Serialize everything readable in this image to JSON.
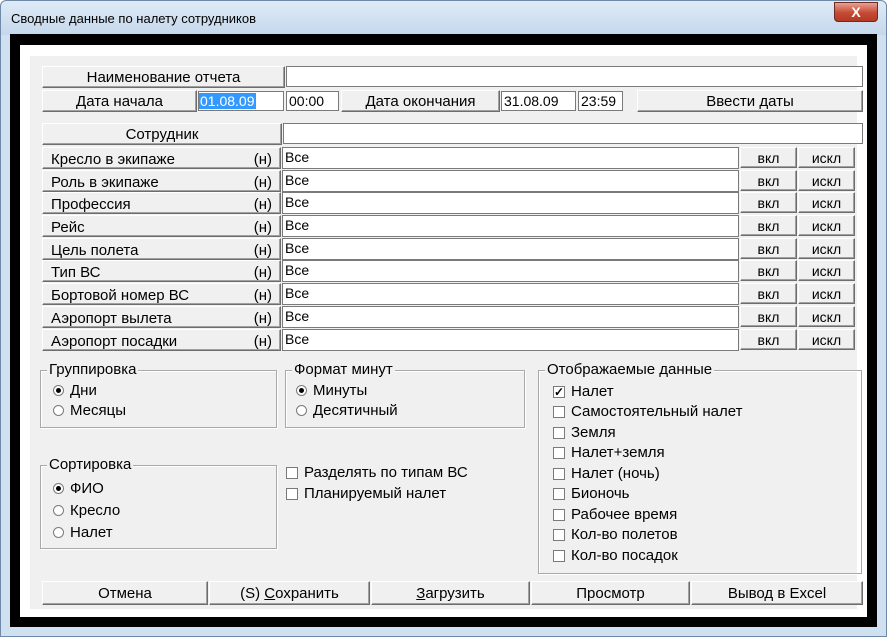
{
  "window": {
    "title": "Сводные данные по налету сотрудников",
    "close_label": "X"
  },
  "report": {
    "name_label": "Наименование отчета",
    "name_value": ""
  },
  "dates": {
    "start_label": "Дата начала",
    "start_date": "01.08.09",
    "start_time": "00:00",
    "end_label": "Дата окончания",
    "end_date": "31.08.09",
    "end_time": "23:59",
    "enter_button": "Ввести даты"
  },
  "employee": {
    "label": "Сотрудник",
    "value": ""
  },
  "filters": [
    {
      "label": "Кресло в экипаже",
      "n": "(н)",
      "value": "Все",
      "incl": "вкл",
      "excl": "искл"
    },
    {
      "label": "Роль в экипаже",
      "n": "(н)",
      "value": "Все",
      "incl": "вкл",
      "excl": "искл"
    },
    {
      "label": "Профессия",
      "n": "(н)",
      "value": "Все",
      "incl": "вкл",
      "excl": "искл"
    },
    {
      "label": "Рейс",
      "n": "(н)",
      "value": "Все",
      "incl": "вкл",
      "excl": "искл"
    },
    {
      "label": "Цель полета",
      "n": "(н)",
      "value": "Все",
      "incl": "вкл",
      "excl": "искл"
    },
    {
      "label": "Тип ВС",
      "n": "(н)",
      "value": "Все",
      "incl": "вкл",
      "excl": "искл"
    },
    {
      "label": "Бортовой номер ВС",
      "n": "(н)",
      "value": "Все",
      "incl": "вкл",
      "excl": "искл"
    },
    {
      "label": "Аэропорт вылета",
      "n": "(н)",
      "value": "Все",
      "incl": "вкл",
      "excl": "искл"
    },
    {
      "label": "Аэропорт посадки",
      "n": "(н)",
      "value": "Все",
      "incl": "вкл",
      "excl": "искл"
    }
  ],
  "grouping": {
    "title": "Группировка",
    "options": [
      "Дни",
      "Месяцы"
    ],
    "selected": 0
  },
  "minute_format": {
    "title": "Формат минут",
    "options": [
      "Минуты",
      "Десятичный"
    ],
    "selected": 0
  },
  "sorting": {
    "title": "Сортировка",
    "options": [
      "ФИО",
      "Кресло",
      "Налет"
    ],
    "selected": 0
  },
  "extra_checks": [
    {
      "label": "Разделять по типам ВС",
      "checked": false
    },
    {
      "label": "Планируемый налет",
      "checked": false
    }
  ],
  "display": {
    "title": "Отображаемые данные",
    "items": [
      {
        "label": "Налет",
        "checked": true
      },
      {
        "label": "Самостоятельный налет",
        "checked": false
      },
      {
        "label": "Земля",
        "checked": false
      },
      {
        "label": "Налет+земля",
        "checked": false
      },
      {
        "label": "Налет (ночь)",
        "checked": false
      },
      {
        "label": "Бионочь",
        "checked": false
      },
      {
        "label": "Рабочее время",
        "checked": false
      },
      {
        "label": "Кол-во полетов",
        "checked": false
      },
      {
        "label": "Кол-во посадок",
        "checked": false
      }
    ]
  },
  "buttons": {
    "cancel": "Отмена",
    "save_prefix": "(S) ",
    "save_hot": "С",
    "save_rest": "охранить",
    "load_hot": "З",
    "load_rest": "агрузить",
    "preview": "Просмотр",
    "excel": "Вывод в Excel"
  }
}
